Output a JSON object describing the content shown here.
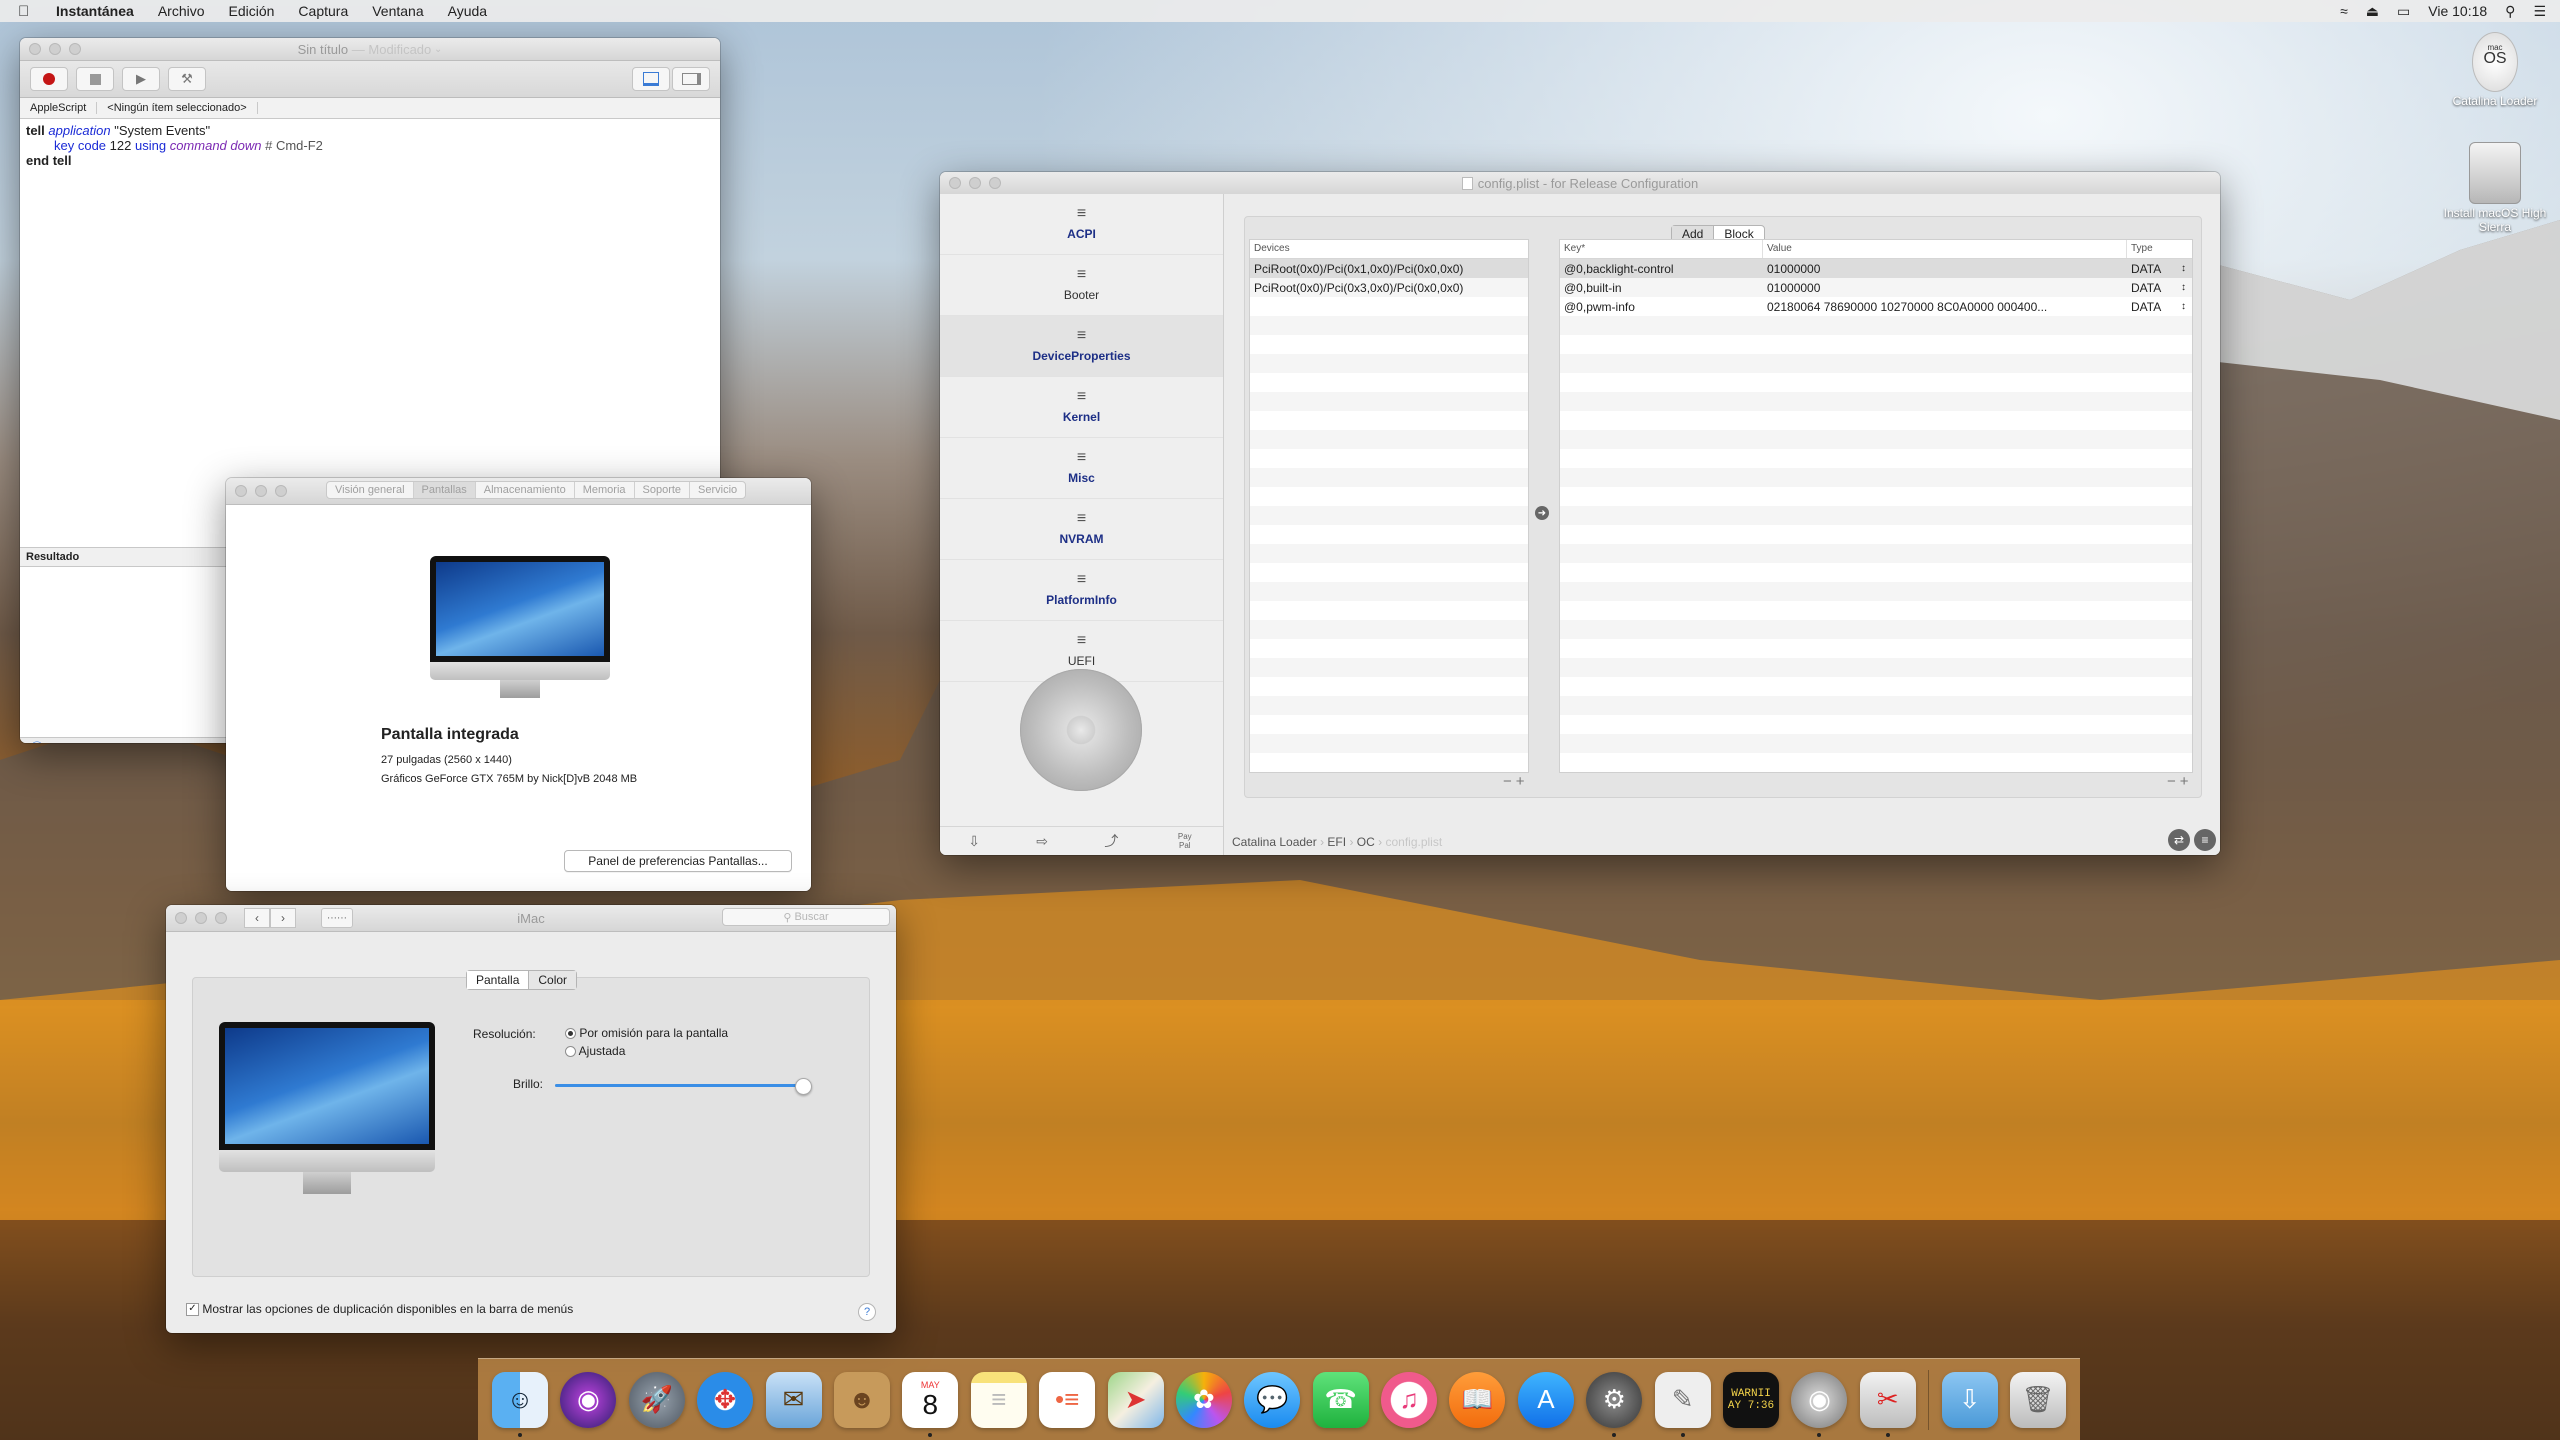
{
  "menubar": {
    "app_name": "Instantánea",
    "items": [
      "Archivo",
      "Edición",
      "Captura",
      "Ventana",
      "Ayuda"
    ],
    "clock": "Vie 10:18"
  },
  "desktop": {
    "icons": [
      {
        "label": "Catalina Loader",
        "badge": "OS",
        "badge_small": "mac"
      },
      {
        "label": "Install macOS High Sierra"
      }
    ]
  },
  "script_editor": {
    "title": "Sin título",
    "title_suffix": "— Modificado",
    "language": "AppleScript",
    "selector": "<Ningún ítem seleccionado>",
    "code": {
      "l1_kw": "tell",
      "l1_app": "application",
      "l1_str": "\"System Events\"",
      "l2_cmd": "key code",
      "l2_num": "122",
      "l2_using": "using",
      "l2_mod": "command down",
      "l2_comment": "# Cmd-F2",
      "l3": "end tell"
    },
    "result_label": "Resultado"
  },
  "about_mac": {
    "tabs": [
      "Visión general",
      "Pantallas",
      "Almacenamiento",
      "Memoria",
      "Soporte",
      "Servicio"
    ],
    "active_tab": "Pantallas",
    "display_name": "Pantalla integrada",
    "size": "27 pulgadas (2560 x 1440)",
    "graphics": "Gráficos GeForce GTX 765M by Nick[D]vB 2048 MB",
    "prefs_button": "Panel de preferencias Pantallas..."
  },
  "display_prefs": {
    "title": "iMac",
    "search_placeholder": "Buscar",
    "tabs": [
      "Pantalla",
      "Color"
    ],
    "resolution_label": "Resolución:",
    "resolution_options": [
      "Por omisión para la pantalla",
      "Ajustada"
    ],
    "resolution_selected": 0,
    "brightness_label": "Brillo:",
    "brightness": 0.97,
    "mirror_checkbox": "Mostrar las opciones de duplicación disponibles en la barra de menús",
    "mirror_checked": true
  },
  "opencore": {
    "title": "config.plist - for Release Configuration",
    "sections": [
      "ACPI",
      "Booter",
      "DeviceProperties",
      "Kernel",
      "Misc",
      "NVRAM",
      "PlatformInfo",
      "UEFI"
    ],
    "selected_section": "DeviceProperties",
    "tabs": [
      "Add",
      "Block"
    ],
    "devices_header": "Devices",
    "devices": [
      "PciRoot(0x0)/Pci(0x1,0x0)/Pci(0x0,0x0)",
      "PciRoot(0x0)/Pci(0x3,0x0)/Pci(0x0,0x0)"
    ],
    "columns": [
      "Key*",
      "Value",
      "Type"
    ],
    "rows": [
      {
        "key": "@0,backlight-control",
        "value": "01000000",
        "type": "DATA"
      },
      {
        "key": "@0,built-in",
        "value": "01000000",
        "type": "DATA"
      },
      {
        "key": "@0,pwm-info",
        "value": "02180064 78690000 10270000 8C0A0000 000400...",
        "type": "DATA"
      }
    ],
    "path": [
      "Catalina Loader",
      "EFI",
      "OC",
      "config.plist"
    ],
    "footer_pay": "Pay Pal"
  },
  "dock": {
    "calendar_month": "MAY",
    "calendar_day": "8",
    "console_text_1": "WARNII",
    "console_text_2": "AY 7:36"
  }
}
